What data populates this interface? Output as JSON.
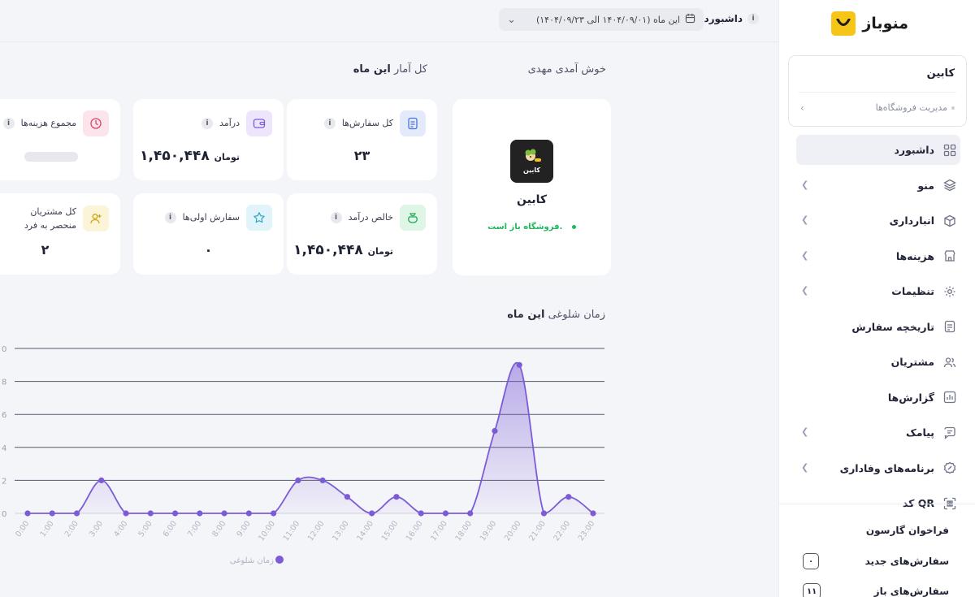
{
  "brand": {
    "name": "منوباز"
  },
  "store_switch": {
    "name": "کابین",
    "manage_label": "مدیریت فروشگاه‌ها"
  },
  "menu": [
    {
      "label": "داشبورد",
      "icon": "grid-icon",
      "active": true,
      "chevron": false
    },
    {
      "label": "منو",
      "icon": "layers-icon",
      "active": false,
      "chevron": true
    },
    {
      "label": "انبارداری",
      "icon": "box-icon",
      "active": false,
      "chevron": true
    },
    {
      "label": "هزینه‌ها",
      "icon": "store-icon",
      "active": false,
      "chevron": true
    },
    {
      "label": "تنظیمات",
      "icon": "gear-icon",
      "active": false,
      "chevron": true
    },
    {
      "label": "تاریخچه سفارش",
      "icon": "receipt-icon",
      "active": false,
      "chevron": false
    },
    {
      "label": "مشتریان",
      "icon": "users-icon",
      "active": false,
      "chevron": false
    },
    {
      "label": "گزارش‌ها",
      "icon": "bar-chart-icon",
      "active": false,
      "chevron": false
    },
    {
      "label": "پیامک",
      "icon": "message-icon",
      "active": false,
      "chevron": true
    },
    {
      "label": "برنامه‌های وفاداری",
      "icon": "percent-badge-icon",
      "active": false,
      "chevron": true
    },
    {
      "label": "کد QR",
      "icon": "qr-icon",
      "active": false,
      "chevron": false
    }
  ],
  "waiter_call": {
    "title": "فراخوان گارسون"
  },
  "order_counters": [
    {
      "label": "سفارش‌های جدید",
      "count": "۰"
    },
    {
      "label": "سفارش‌های باز",
      "count": "۱۱"
    }
  ],
  "topbar": {
    "breadcrumb": "داشبورد",
    "info": "i",
    "date_range": "این ماه (۱۴۰۴/۰۹/۰۱ الی ۱۴۰۴/۰۹/۲۳)"
  },
  "welcome": "خوش آمدی مهدی",
  "stats_title": {
    "prefix": "کل آمار",
    "highlight": "این ماه"
  },
  "store_card": {
    "name": "کابین",
    "status": "فروشگاه باز است.",
    "logo_text": "کابین"
  },
  "cards": {
    "orders": {
      "title": "کل سفارش‌ها",
      "value": "۲۳"
    },
    "revenue": {
      "title": "درآمد",
      "value": "۱,۴۵۰,۴۴۸",
      "unit": "تومان"
    },
    "expenses": {
      "title": "مجموع هزینه‌ها"
    },
    "net": {
      "title": "خالص درآمد",
      "value": "۱,۴۵۰,۴۴۸",
      "unit": "تومان"
    },
    "first_orders": {
      "title": "سفارش اولی‌ها",
      "value": "۰"
    },
    "unique_customers": {
      "title": "کل مشتریان منحصر به فرد",
      "value": "۲"
    }
  },
  "chart_title": {
    "prefix": "زمان شلوغی",
    "highlight": "این ماه"
  },
  "colors": {
    "accent": "#7c5cd6",
    "brand_yellow": "#f5c518",
    "open_green": "#1fb85c"
  },
  "chart_data": {
    "type": "area",
    "x": [
      "0:00",
      "1:00",
      "2:00",
      "3:00",
      "4:00",
      "5:00",
      "6:00",
      "7:00",
      "8:00",
      "9:00",
      "10:00",
      "11:00",
      "12:00",
      "13:00",
      "14:00",
      "15:00",
      "16:00",
      "17:00",
      "18:00",
      "19:00",
      "20:00",
      "21:00",
      "22:00",
      "23:00"
    ],
    "series": [
      {
        "name": "زمان شلوغی",
        "values": [
          0,
          0,
          0,
          2,
          0,
          0,
          0,
          0,
          0,
          0,
          0,
          2,
          2,
          1,
          0,
          1,
          0,
          0,
          0,
          5,
          9,
          0,
          1,
          0
        ]
      }
    ],
    "yticks": [
      "0",
      "2",
      "4",
      "6",
      "8",
      "0"
    ],
    "ylim": [
      0,
      10
    ],
    "grid": true,
    "legend": "bottom-center"
  }
}
